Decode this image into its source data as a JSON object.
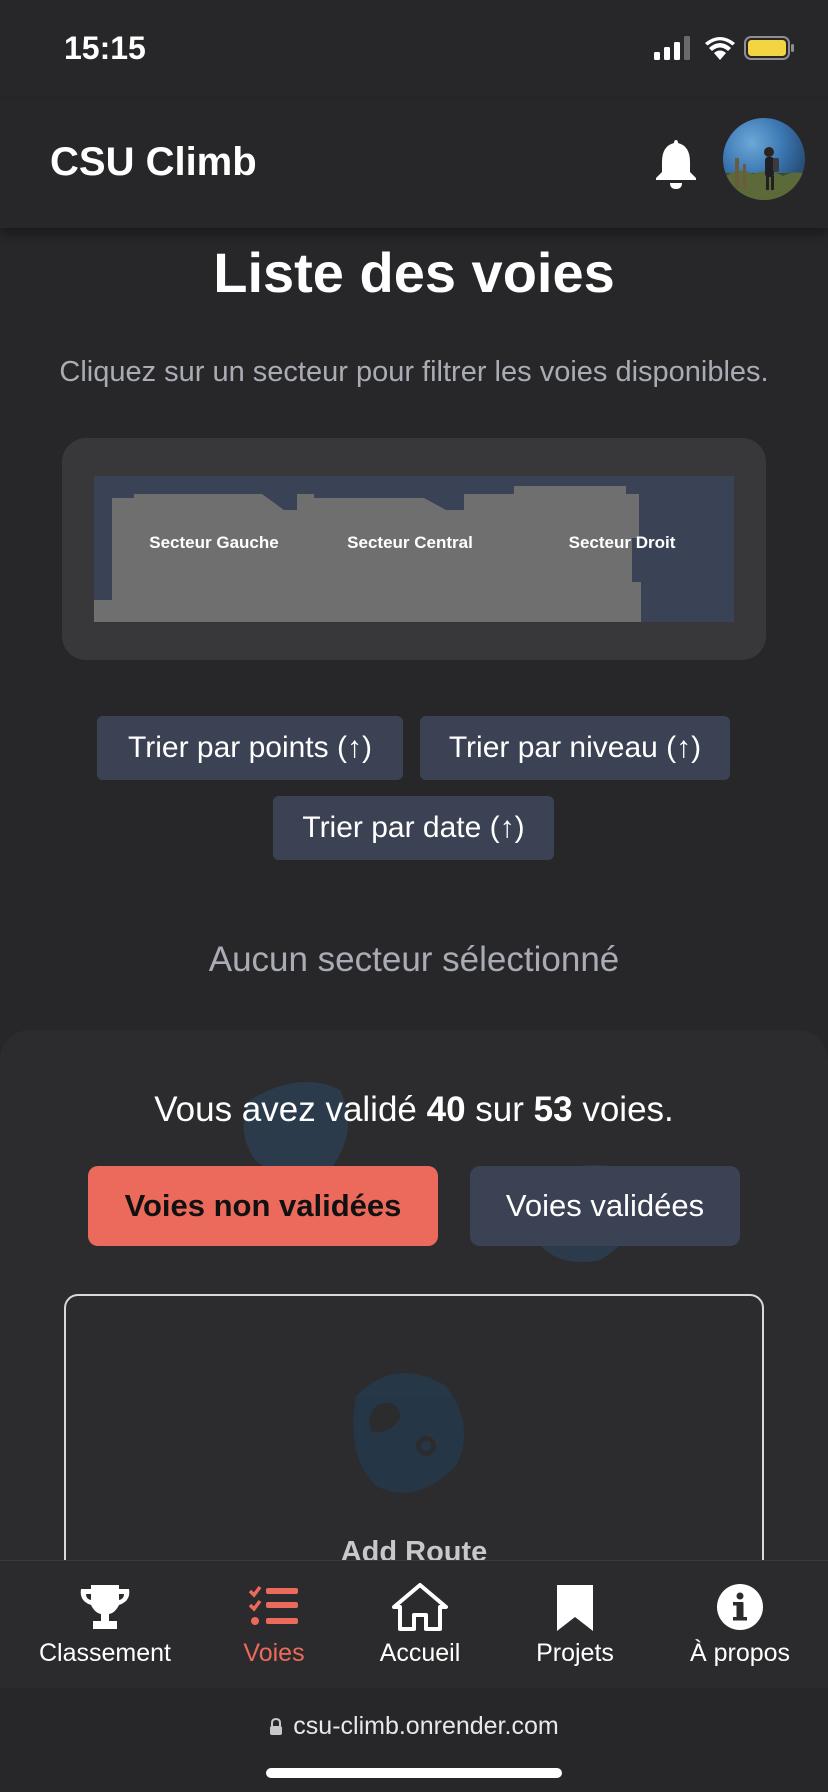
{
  "status_bar": {
    "time": "15:15"
  },
  "header": {
    "app_title": "CSU Climb"
  },
  "page": {
    "title": "Liste des voies",
    "subtitle": "Cliquez sur un secteur pour filtrer les voies disponibles."
  },
  "map": {
    "sectors": [
      "Secteur Gauche",
      "Secteur Central",
      "Secteur Droit"
    ]
  },
  "sort": {
    "points": "Trier par points (↑)",
    "level": "Trier par niveau (↑)",
    "date": "Trier par date (↑)"
  },
  "filter": {
    "no_sector": "Aucun secteur sélectionné"
  },
  "progress": {
    "prefix": "Vous avez validé",
    "validated": "40",
    "middle": "sur",
    "total": "53",
    "suffix": "voies."
  },
  "tabs": {
    "not_validated": "Voies non validées",
    "validated": "Voies validées"
  },
  "add_route": {
    "label": "Add Route"
  },
  "bottom_nav": {
    "items": [
      {
        "label": "Classement",
        "icon": "trophy-icon"
      },
      {
        "label": "Voies",
        "icon": "list-check-icon"
      },
      {
        "label": "Accueil",
        "icon": "home-icon"
      },
      {
        "label": "Projets",
        "icon": "bookmark-icon"
      },
      {
        "label": "À propos",
        "icon": "info-icon"
      }
    ]
  },
  "browser": {
    "url": "csu-climb.onrender.com"
  },
  "colors": {
    "accent": "#ec6a5c",
    "button_bg": "#3b4254",
    "background": "#272729"
  }
}
